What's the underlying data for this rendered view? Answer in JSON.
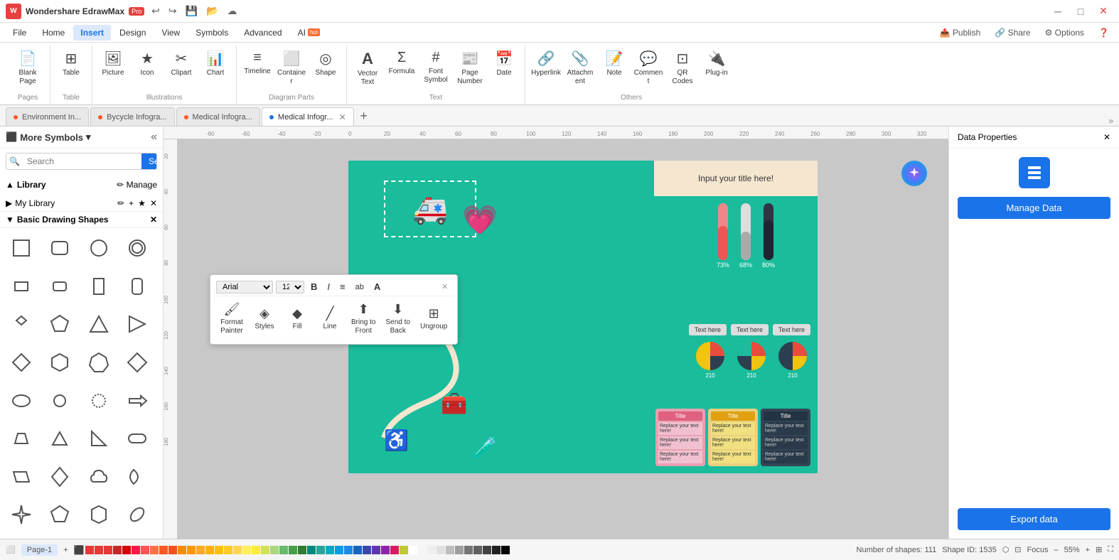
{
  "app": {
    "name": "Wondershare EdrawMax",
    "badge": "Pro",
    "title": "Wondershare EdrawMax Pro"
  },
  "titlebar": {
    "undo": "↩",
    "redo": "↪",
    "save_icon": "💾",
    "folder_icon": "📁",
    "minimize": "─",
    "maximize": "□",
    "close": "✕"
  },
  "menu": {
    "items": [
      "File",
      "Home",
      "Insert",
      "Design",
      "View",
      "Symbols",
      "Advanced",
      "AI"
    ],
    "active": "Insert",
    "right": {
      "publish": "Publish",
      "share": "Share",
      "options": "Options",
      "help": "?"
    }
  },
  "ribbon": {
    "groups": [
      {
        "label": "Pages",
        "items": [
          {
            "id": "blank-page",
            "icon": "📄",
            "label": "Blank\nPage",
            "has_arrow": true
          }
        ]
      },
      {
        "label": "Table",
        "items": [
          {
            "id": "table",
            "icon": "⊞",
            "label": "Table"
          }
        ]
      },
      {
        "label": "Illustrations",
        "items": [
          {
            "id": "picture",
            "icon": "🖼",
            "label": "Picture"
          },
          {
            "id": "icon",
            "icon": "★",
            "label": "Icon"
          },
          {
            "id": "clipart",
            "icon": "✂",
            "label": "Clipart"
          },
          {
            "id": "chart",
            "icon": "📊",
            "label": "Chart"
          }
        ]
      },
      {
        "label": "Diagram Parts",
        "items": [
          {
            "id": "timeline",
            "icon": "≡",
            "label": "Timeline"
          },
          {
            "id": "container",
            "icon": "⬜",
            "label": "Container"
          },
          {
            "id": "shape",
            "icon": "◎",
            "label": "Shape"
          }
        ]
      },
      {
        "label": "Text",
        "items": [
          {
            "id": "vector-text",
            "icon": "A",
            "label": "Vector\nText"
          },
          {
            "id": "formula",
            "icon": "Σ",
            "label": "Formula"
          },
          {
            "id": "font-symbol",
            "icon": "#",
            "label": "Font\nSymbol"
          },
          {
            "id": "page-number",
            "icon": "📰",
            "label": "Page\nNumber"
          },
          {
            "id": "date",
            "icon": "📅",
            "label": "Date"
          }
        ]
      },
      {
        "label": "Others",
        "items": [
          {
            "id": "hyperlink",
            "icon": "🔗",
            "label": "Hyperlink"
          },
          {
            "id": "attachment",
            "icon": "📎",
            "label": "Attachment"
          },
          {
            "id": "note",
            "icon": "📝",
            "label": "Note"
          },
          {
            "id": "comment",
            "icon": "💬",
            "label": "Comment"
          },
          {
            "id": "qr-codes",
            "icon": "⊡",
            "label": "QR\nCodes"
          },
          {
            "id": "plugin",
            "icon": "🔌",
            "label": "Plug-in"
          }
        ]
      }
    ]
  },
  "sidebar": {
    "title": "More Symbols",
    "search": {
      "placeholder": "Search",
      "button": "Search"
    },
    "library": {
      "label": "Library",
      "manage": "Manage"
    },
    "my_library": {
      "label": "My Library",
      "plus": "+",
      "close": "✕",
      "star": "★"
    },
    "basic_shapes": {
      "label": "Basic Drawing Shapes",
      "close": "✕"
    }
  },
  "tabs": [
    {
      "id": "env",
      "label": "Environment In...",
      "dot": "orange",
      "closable": false
    },
    {
      "id": "bicycle",
      "label": "Bycycle Infogra...",
      "dot": "orange",
      "closable": false
    },
    {
      "id": "medical1",
      "label": "Medical Infogra...",
      "dot": "orange",
      "closable": false
    },
    {
      "id": "medical2",
      "label": "Medical Infogr...",
      "dot": "blue",
      "closable": true,
      "active": true
    }
  ],
  "floating_toolbar": {
    "font": "Arial",
    "size": "12",
    "bold": "B",
    "italic": "I",
    "align": "≡",
    "lowercase": "ab",
    "uppercase": "A",
    "tools": [
      {
        "id": "format-painter",
        "icon": "🖌",
        "label": "Format\nPainter"
      },
      {
        "id": "styles",
        "icon": "◈",
        "label": "Styles"
      },
      {
        "id": "fill",
        "icon": "◆",
        "label": "Fill"
      },
      {
        "id": "line",
        "icon": "╱",
        "label": "Line"
      },
      {
        "id": "bring-to-front",
        "icon": "⬆",
        "label": "Bring to\nFront"
      },
      {
        "id": "send-to-back",
        "icon": "⬇",
        "label": "Send to\nBack"
      },
      {
        "id": "ungroup",
        "icon": "⊞",
        "label": "Ungroup"
      }
    ]
  },
  "right_sidebar": {
    "title": "Data Properties",
    "manage_btn": "Manage Data",
    "export_btn": "Export data"
  },
  "bottom_bar": {
    "page_indicator": "Page-1",
    "status": "Number of shapes: 111",
    "shape_id": "Shape ID: 1535",
    "focus": "Focus",
    "zoom": "55%"
  },
  "colors": [
    "#e53935",
    "#e53935",
    "#e53935",
    "#c62828",
    "#d50000",
    "#ff1744",
    "#ff5252",
    "#ff7043",
    "#ff5722",
    "#f4511e",
    "#fb8c00",
    "#ff9800",
    "#ffa726",
    "#ffb300",
    "#ffc107",
    "#ffca28",
    "#ffd54f",
    "#ffee58",
    "#ffeb3b",
    "#d4e157",
    "#aed581",
    "#66bb6a",
    "#43a047",
    "#2e7d32",
    "#00897b",
    "#26a69a",
    "#00acc1",
    "#039be5",
    "#1e88e5",
    "#1565c0",
    "#3949ab",
    "#5e35b1",
    "#8e24aa",
    "#d81b60",
    "#c0ca33",
    "#ffffff",
    "#f5f5f5",
    "#eeeeee",
    "#e0e0e0",
    "#bdbdbd",
    "#9e9e9e",
    "#757575",
    "#616161",
    "#424242",
    "#212121",
    "#000000"
  ]
}
